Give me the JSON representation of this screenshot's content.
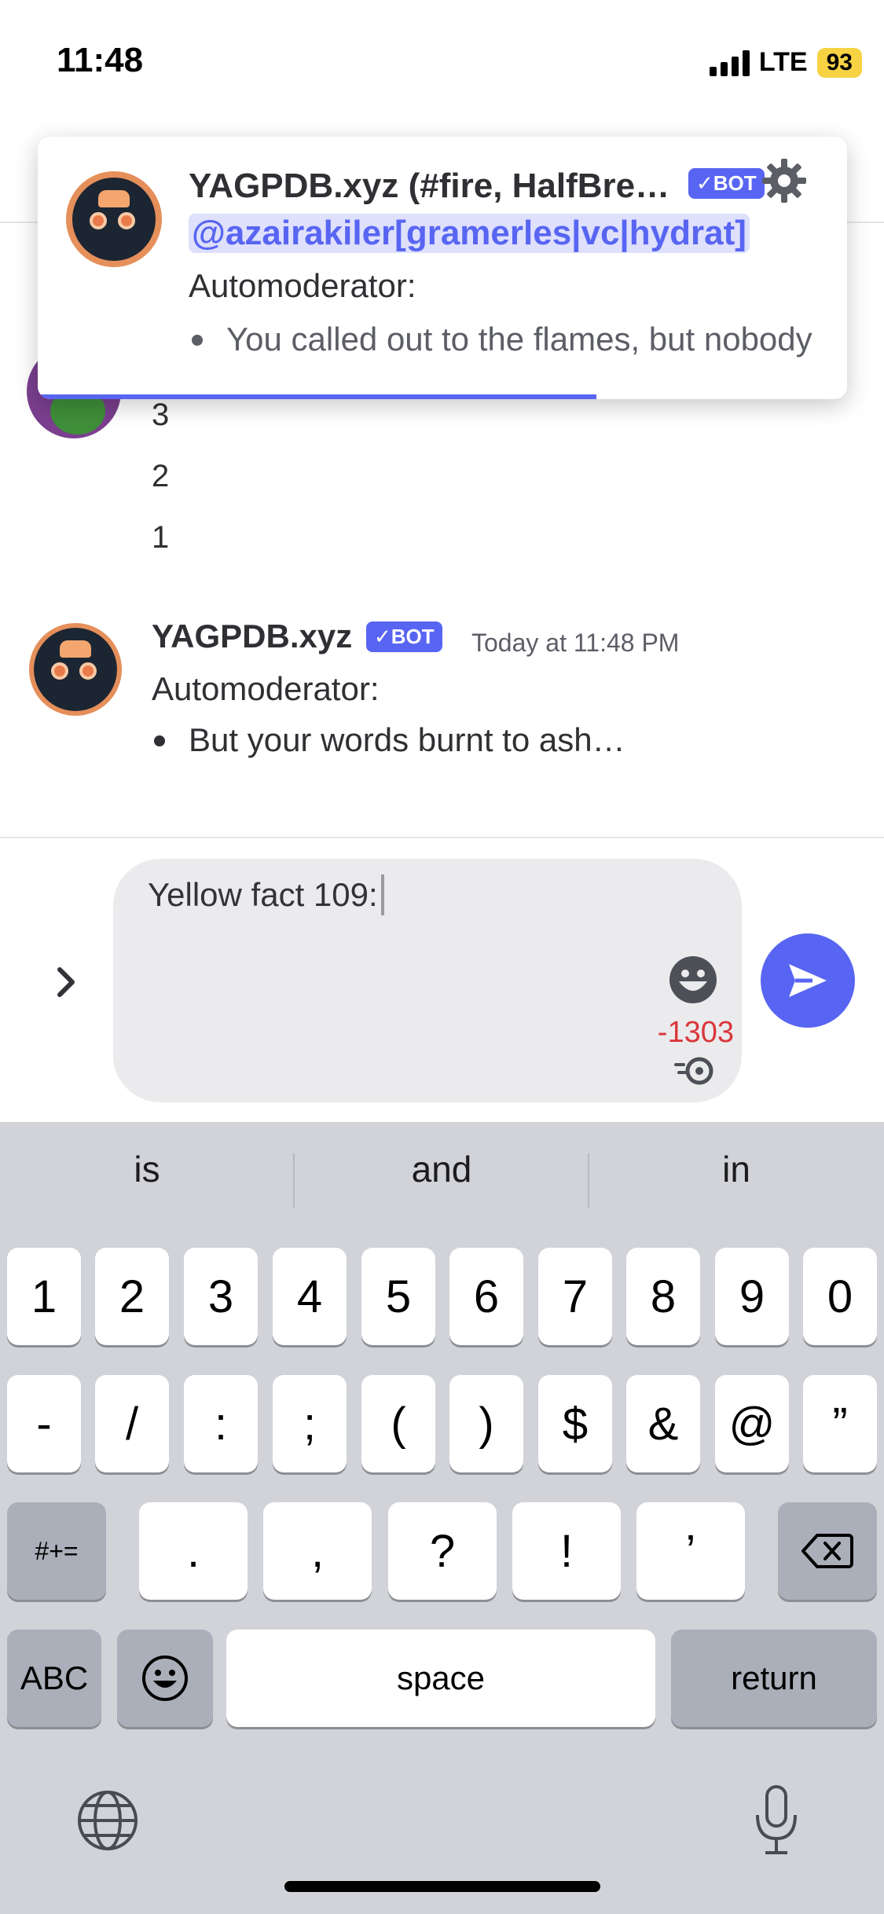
{
  "status": {
    "time": "11:48",
    "network": "LTE",
    "battery": "93"
  },
  "notification": {
    "title": "YAGPDB.xyz (#fire, HalfBre…",
    "bot_tag": "✓BOT",
    "mention": "@azairakiler[gramerles|vc|hydrat]",
    "line1": "Automoderator:",
    "bullet": "You called out to the flames, but nobody came",
    "progress": 0.69
  },
  "chat": {
    "countdown": [
      "3",
      "2",
      "1"
    ],
    "message": {
      "author": "YAGPDB.xyz",
      "bot_tag": "✓BOT",
      "timestamp": "Today at 11:48 PM",
      "line1": "Automoderator:",
      "bullet": "But your words burnt to ash…"
    }
  },
  "composer": {
    "text": "Yellow fact 109:",
    "char_count": "-1303"
  },
  "keyboard": {
    "suggestions": [
      "is",
      "and",
      "in"
    ],
    "row1": [
      "1",
      "2",
      "3",
      "4",
      "5",
      "6",
      "7",
      "8",
      "9",
      "0"
    ],
    "row2": [
      "-",
      "/",
      ":",
      ";",
      "(",
      ")",
      "$",
      "&",
      "@",
      "”"
    ],
    "row3": [
      ".",
      ",",
      "?",
      "!",
      "’"
    ],
    "symbols_key": "#+=",
    "abc_key": "ABC",
    "space_key": "space",
    "return_key": "return"
  },
  "colors": {
    "accent": "#5865f2",
    "error": "#da373c"
  }
}
